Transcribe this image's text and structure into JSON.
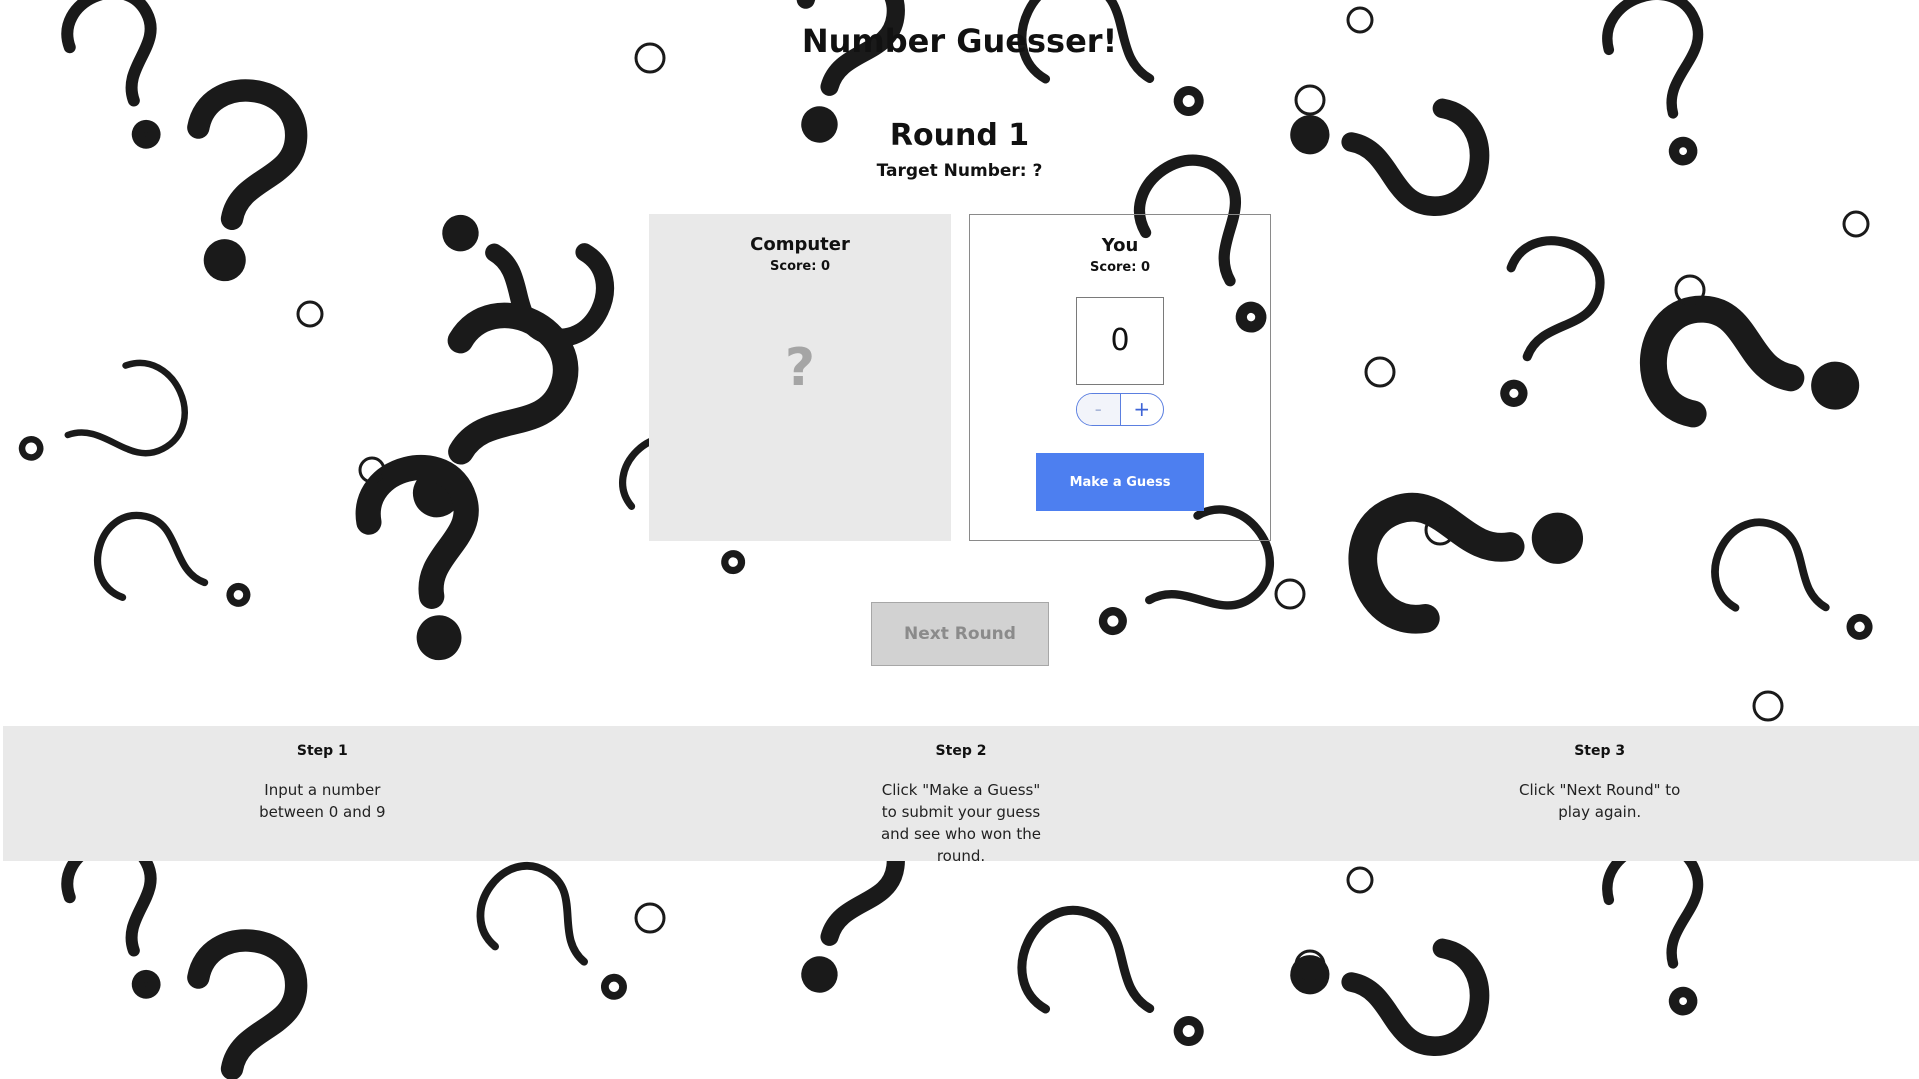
{
  "app": {
    "title": "Number Guesser!"
  },
  "round": {
    "label": "Round 1",
    "target": "Target Number: ?"
  },
  "computer": {
    "name": "Computer",
    "score": "Score: 0",
    "guess": "?"
  },
  "player": {
    "name": "You",
    "score": "Score: 0",
    "guess_value": "0",
    "decrement_label": "-",
    "increment_label": "+",
    "guess_button_label": "Make a Guess"
  },
  "next_round_label": "Next Round",
  "steps": [
    {
      "title": "Step 1",
      "text": "Input a number between 0 and 9"
    },
    {
      "title": "Step 2",
      "text": "Click \"Make a Guess\" to submit your guess and see who won the round."
    },
    {
      "title": "Step 3",
      "text": "Click \"Next Round\" to play again."
    }
  ],
  "colors": {
    "accent": "#4d7ff0",
    "panel": "#e9e9e9",
    "disabled_button": "#d2d2d2"
  }
}
